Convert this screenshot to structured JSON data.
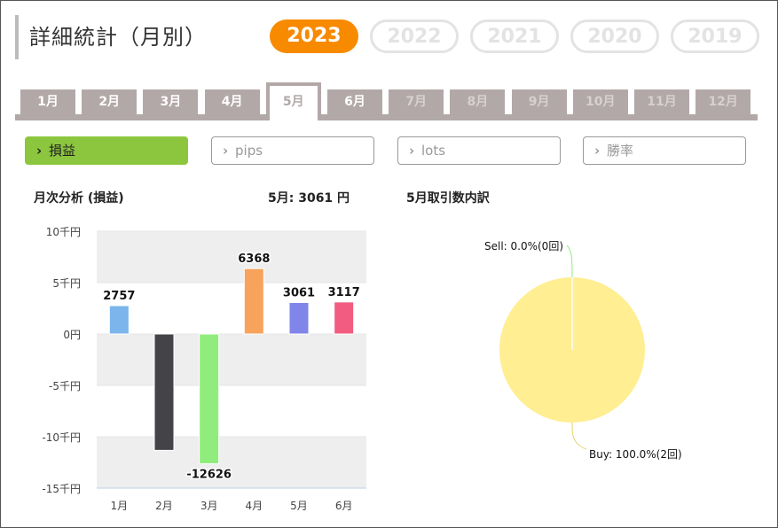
{
  "page": {
    "title": "詳細統計（月別）"
  },
  "years": [
    {
      "label": "2023",
      "active": true
    },
    {
      "label": "2022",
      "active": false
    },
    {
      "label": "2021",
      "active": false
    },
    {
      "label": "2020",
      "active": false
    },
    {
      "label": "2019",
      "active": false
    }
  ],
  "months": [
    {
      "label": "1月",
      "state": "enabled"
    },
    {
      "label": "2月",
      "state": "enabled"
    },
    {
      "label": "3月",
      "state": "enabled"
    },
    {
      "label": "4月",
      "state": "enabled"
    },
    {
      "label": "5月",
      "state": "active"
    },
    {
      "label": "6月",
      "state": "enabled"
    },
    {
      "label": "7月",
      "state": "disabled"
    },
    {
      "label": "8月",
      "state": "disabled"
    },
    {
      "label": "9月",
      "state": "disabled"
    },
    {
      "label": "10月",
      "state": "disabled"
    },
    {
      "label": "11月",
      "state": "disabled"
    },
    {
      "label": "12月",
      "state": "disabled"
    }
  ],
  "metrics": [
    {
      "label": "損益",
      "active": true
    },
    {
      "label": "pips",
      "active": false
    },
    {
      "label": "lots",
      "active": false
    },
    {
      "label": "勝率",
      "active": false
    }
  ],
  "monthly": {
    "heading": "月次分析 (損益)",
    "summary": "5月:  3061 円"
  },
  "breakdown": {
    "heading": "5月取引数内訳"
  },
  "colors": {
    "accent_year": "#f88a00",
    "accent_metric": "#8cc63f",
    "tab": "#b3a8a8"
  },
  "chart_data": [
    {
      "type": "bar",
      "categories": [
        "1月",
        "2月",
        "3月",
        "4月",
        "5月",
        "6月"
      ],
      "values": [
        2757,
        -11325,
        -12626,
        6368,
        3061,
        3117
      ],
      "data_labels": [
        "2757",
        "",
        "-12626",
        "6368",
        "3061",
        "3117"
      ],
      "colors": [
        "#7cb5ec",
        "#434348",
        "#90ed7d",
        "#f7a35c",
        "#8085e9",
        "#f15c80"
      ],
      "y_ticks": [
        {
          "value": 10000,
          "label": "10千円"
        },
        {
          "value": 5000,
          "label": "5千円"
        },
        {
          "value": 0,
          "label": "0円"
        },
        {
          "value": -5000,
          "label": "-5千円"
        },
        {
          "value": -10000,
          "label": "-10千円"
        },
        {
          "value": -15000,
          "label": "-15千円"
        }
      ],
      "ylim": [
        -15000,
        10000
      ],
      "grid": "alternating bands"
    },
    {
      "type": "pie",
      "slices": [
        {
          "label": "Sell: 0.0%(0回)",
          "value": 0,
          "color": "#90ed7d"
        },
        {
          "label": "Buy: 100.0%(2回)",
          "value": 100,
          "color": "#ffee92"
        }
      ]
    }
  ]
}
